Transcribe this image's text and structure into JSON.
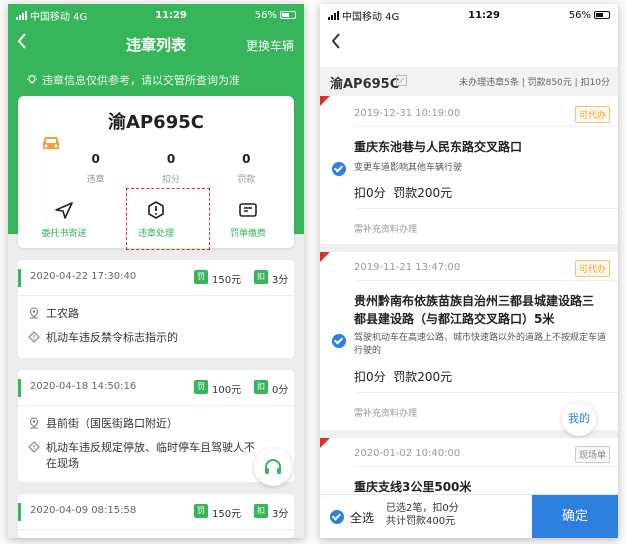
{
  "colors": {
    "accent_green": "#37b55a",
    "accent_blue": "#2d7fe0",
    "warning_red": "#d8322c",
    "can_orange": "#f0a03a"
  },
  "left": {
    "status": {
      "carrier": "中国移动 4G",
      "time": "11:29",
      "battery": "56%"
    },
    "nav": {
      "back_icon": "chevron-left-icon",
      "title": "违章列表",
      "right_action": "更换车辆"
    },
    "notice": {
      "icon": "lightbulb-icon",
      "text": "违章信息仅供参考，请以交管所查询为准"
    },
    "car": {
      "plate": "渝AP695C",
      "icon": "car-icon",
      "stats": [
        {
          "value": "0",
          "label": "违章"
        },
        {
          "value": "0",
          "label": "扣分"
        },
        {
          "value": "0",
          "label": "罚款"
        }
      ],
      "actions": [
        {
          "icon": "send-icon",
          "label": "委托书寄送"
        },
        {
          "icon": "violation-icon",
          "label": "违章处理"
        },
        {
          "icon": "ticket-icon",
          "label": "罚单缴费"
        }
      ]
    },
    "records": [
      {
        "date": "2020-04-22 17:30:40",
        "fine_tag": "罚",
        "fine": "150元",
        "points_tag": "扣",
        "points": "3分",
        "location": "工农路",
        "reason": "机动车违反禁令标志指示的"
      },
      {
        "date": "2020-04-18 14:50:16",
        "fine_tag": "罚",
        "fine": "100元",
        "points_tag": "扣",
        "points": "0分",
        "location": "县前街（国医街路口附近）",
        "reason": "机动车违反规定停放、临时停车且驾驶人不在现场"
      },
      {
        "date": "2020-04-09 08:15:58",
        "fine_tag": "罚",
        "fine": "150元",
        "points_tag": "扣",
        "points": "3分"
      }
    ],
    "support_icon": "headset-icon"
  },
  "right": {
    "status": {
      "carrier": "中国移动 4G",
      "time": "11:29",
      "battery": "56%"
    },
    "back_icon": "chevron-left-icon",
    "header": {
      "plate": "渝AP695C",
      "edit_icon": "edit-icon",
      "summary": "未办理违章5条 | 罚款850元 | 扣10分"
    },
    "cards": [
      {
        "date": "2019-12-31 10:19:00",
        "status": "可代办",
        "address": "重庆东池巷与人民东路交叉路口",
        "desc": "变更车道影响其他车辆行驶",
        "points": "扣0分",
        "fine": "罚款200元",
        "supplement": "需补充资料办理"
      },
      {
        "date": "2019-11-21 13:47:00",
        "status": "可代办",
        "address": "贵州黔南布依族苗族自治州三都县城建设路三都县建设路（与都江路交叉路口）5米",
        "desc": "驾驶机动车在高速公路、城市快速路以外的道路上不按规定车道行驶的",
        "points": "扣0分",
        "fine": "罚款200元",
        "supplement": "需补充资料办理"
      },
      {
        "date": "2020-01-02 10:40:00",
        "status": "现场单",
        "address": "重庆支线3公里500米"
      }
    ],
    "mine_button": "我的",
    "bottom": {
      "select_all": "全选",
      "selected_line1": "已选2笔，扣0分",
      "selected_line2": "共计罚款400元",
      "confirm": "确定"
    }
  }
}
